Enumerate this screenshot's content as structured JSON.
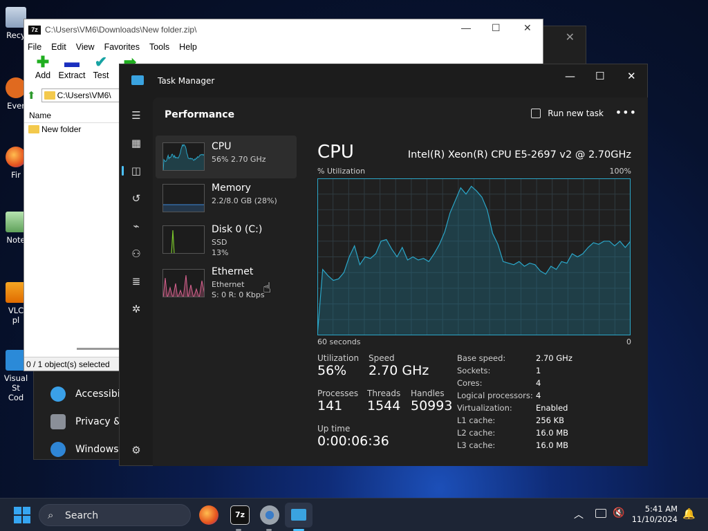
{
  "desktop": {
    "icons": [
      {
        "label": "Recy"
      },
      {
        "label": "Ever"
      },
      {
        "label": "Fir"
      },
      {
        "label": "Note"
      },
      {
        "label": "VLC"
      },
      {
        "label": "pl"
      },
      {
        "label": "Visual St"
      },
      {
        "label": "Cod"
      }
    ]
  },
  "settings_bg": {
    "items": [
      "Accessibili",
      "Privacy & s",
      "Windows U"
    ]
  },
  "sevenzip": {
    "title": "C:\\Users\\VM6\\Downloads\\New folder.zip\\",
    "logo": "7z",
    "menu": [
      "File",
      "Edit",
      "View",
      "Favorites",
      "Tools",
      "Help"
    ],
    "toolbar": [
      "Add",
      "Extract",
      "Test",
      "C"
    ],
    "address": "C:\\Users\\VM6\\",
    "column_name": "Name",
    "items": [
      "New folder"
    ],
    "status": "0 / 1 object(s) selected"
  },
  "taskmgr": {
    "title": "Task Manager",
    "page_title": "Performance",
    "run_new_task": "Run new task",
    "more": "•••",
    "sidebar": [
      {
        "name": "CPU",
        "sub1": "56%  2.70 GHz",
        "sub2": ""
      },
      {
        "name": "Memory",
        "sub1": "2.2/8.0 GB (28%)",
        "sub2": ""
      },
      {
        "name": "Disk 0 (C:)",
        "sub1": "SSD",
        "sub2": "13%"
      },
      {
        "name": "Ethernet",
        "sub1": "Ethernet",
        "sub2": "S: 0  R: 0 Kbps"
      }
    ],
    "detail": {
      "heading": "CPU",
      "model": "Intel(R) Xeon(R) CPU E5-2697 v2 @ 2.70GHz",
      "util_label": "% Utilization",
      "max_label": "100%",
      "time_label": "60 seconds",
      "min_label": "0",
      "stats": {
        "utilization": {
          "label": "Utilization",
          "value": "56%"
        },
        "speed": {
          "label": "Speed",
          "value": "2.70 GHz"
        },
        "processes": {
          "label": "Processes",
          "value": "141"
        },
        "threads": {
          "label": "Threads",
          "value": "1544"
        },
        "handles": {
          "label": "Handles",
          "value": "50993"
        },
        "uptime": {
          "label": "Up time",
          "value": "0:00:06:36"
        }
      },
      "specs": [
        {
          "k": "Base speed:",
          "v": "2.70 GHz"
        },
        {
          "k": "Sockets:",
          "v": "1"
        },
        {
          "k": "Cores:",
          "v": "4"
        },
        {
          "k": "Logical processors:",
          "v": "4"
        },
        {
          "k": "Virtualization:",
          "v": "Enabled"
        },
        {
          "k": "L1 cache:",
          "v": "256 KB"
        },
        {
          "k": "L2 cache:",
          "v": "16.0 MB"
        },
        {
          "k": "L3 cache:",
          "v": "16.0 MB"
        }
      ]
    },
    "cpu_history": [
      0,
      42,
      38,
      35,
      36,
      40,
      50,
      57,
      45,
      50,
      49,
      52,
      60,
      61,
      55,
      50,
      56,
      48,
      50,
      48,
      49,
      47,
      52,
      58,
      66,
      78,
      86,
      94,
      90,
      95,
      92,
      88,
      80,
      65,
      58,
      47,
      46,
      45,
      47,
      44,
      46,
      45,
      41,
      39,
      44,
      42,
      47,
      46,
      52,
      50,
      52,
      56,
      59,
      58,
      60,
      60,
      57,
      60,
      56,
      60
    ]
  },
  "taskbar": {
    "search_placeholder": "Search",
    "time": "5:41 AM",
    "date": "11/10/2024"
  },
  "colors": {
    "accent": "#4cc2ff",
    "cpu_line": "#2ba7c9",
    "memory_line": "#3d87d9",
    "disk_line": "#7ac52b",
    "ethernet_line": "#d8628f"
  }
}
